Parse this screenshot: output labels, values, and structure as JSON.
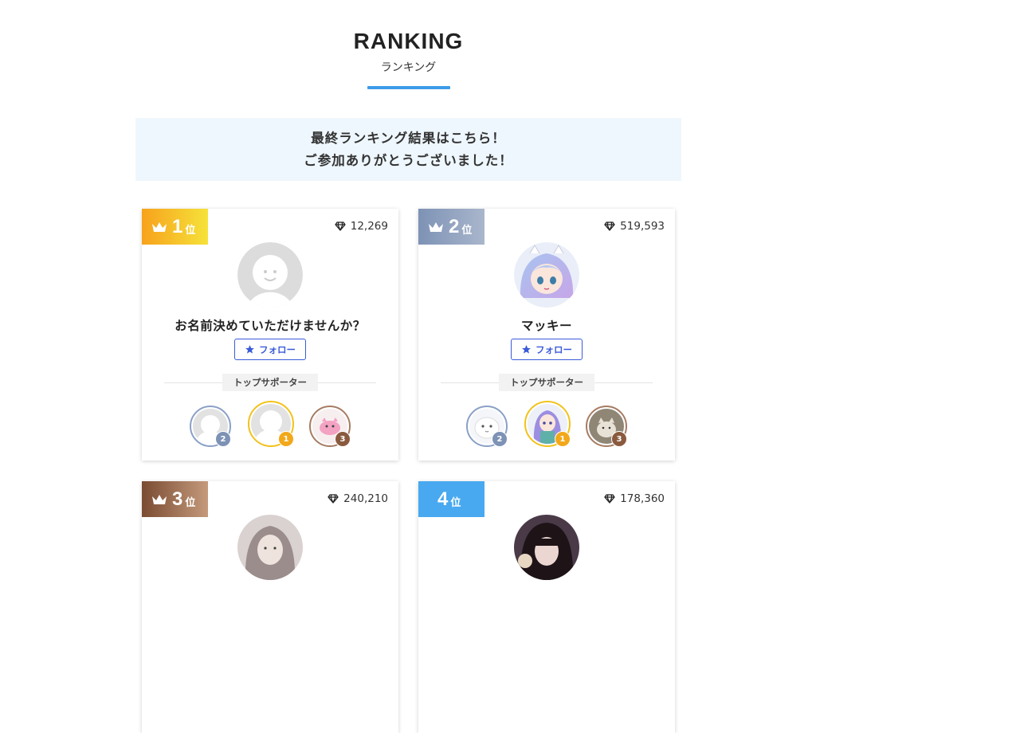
{
  "page": {
    "title": "RANKING",
    "subtitle": "ランキング",
    "notice_line1": "最終ランキング結果はこちら！",
    "notice_line2": "ご参加ありがとうございました！"
  },
  "supporter_label": "トップサポーター",
  "follow_label": "フォロー",
  "rank_suffix": "位",
  "cards": [
    {
      "rank": "1",
      "points": "12,269",
      "name": "お名前決めていただけませんか？",
      "avatar": "default-avatar",
      "badge_color": "gold",
      "supporters": [
        {
          "rank": "2",
          "avatar": "default-avatar"
        },
        {
          "rank": "1",
          "avatar": "default-avatar"
        },
        {
          "rank": "3",
          "avatar": "pink-character-avatar"
        }
      ]
    },
    {
      "rank": "2",
      "points": "519,593",
      "name": "マッキー",
      "avatar": "anime-character-avatar",
      "badge_color": "silver",
      "supporters": [
        {
          "rank": "2",
          "avatar": "white-cat-avatar"
        },
        {
          "rank": "1",
          "avatar": "anime-character-avatar"
        },
        {
          "rank": "3",
          "avatar": "cat-photo-avatar"
        }
      ]
    },
    {
      "rank": "3",
      "points": "240,210",
      "avatar": "photo-avatar",
      "badge_color": "bronze"
    },
    {
      "rank": "4",
      "points": "178,360",
      "avatar": "photo-avatar",
      "badge_color": "blue"
    }
  ],
  "colors": {
    "gold_from": "#f7a21c",
    "gold_to": "#f6e23a",
    "silver_from": "#7d92b5",
    "silver_to": "#a9b6cc",
    "bronze_from": "#7a4b32",
    "bronze_to": "#c49a7b",
    "blue": "#48a9f0",
    "accent": "#3d9be9",
    "follow": "#3a5bd9"
  }
}
